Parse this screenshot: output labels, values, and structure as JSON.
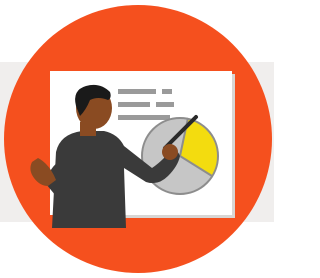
{
  "illustration": {
    "subject": "presenter-at-whiteboard",
    "icons": [
      "presenter-figure",
      "pie-chart-icon",
      "pointer-stick",
      "text-lines"
    ]
  },
  "colors": {
    "page_background": "#ffffff",
    "backdrop_band": "#f0eeed",
    "circle": "#f5501e",
    "board": "#ffffff",
    "board_shadow": "#d8d6d4",
    "text_line": "#9a9a9a",
    "pie_main": "#c6c6c6",
    "pie_slice": "#f3dc0f",
    "pie_outline": "#8d8d8d",
    "shirt": "#3a3a3a",
    "skin": "#8a4b22",
    "hair": "#1a1a1a",
    "pointer": "#2a2a2a"
  }
}
